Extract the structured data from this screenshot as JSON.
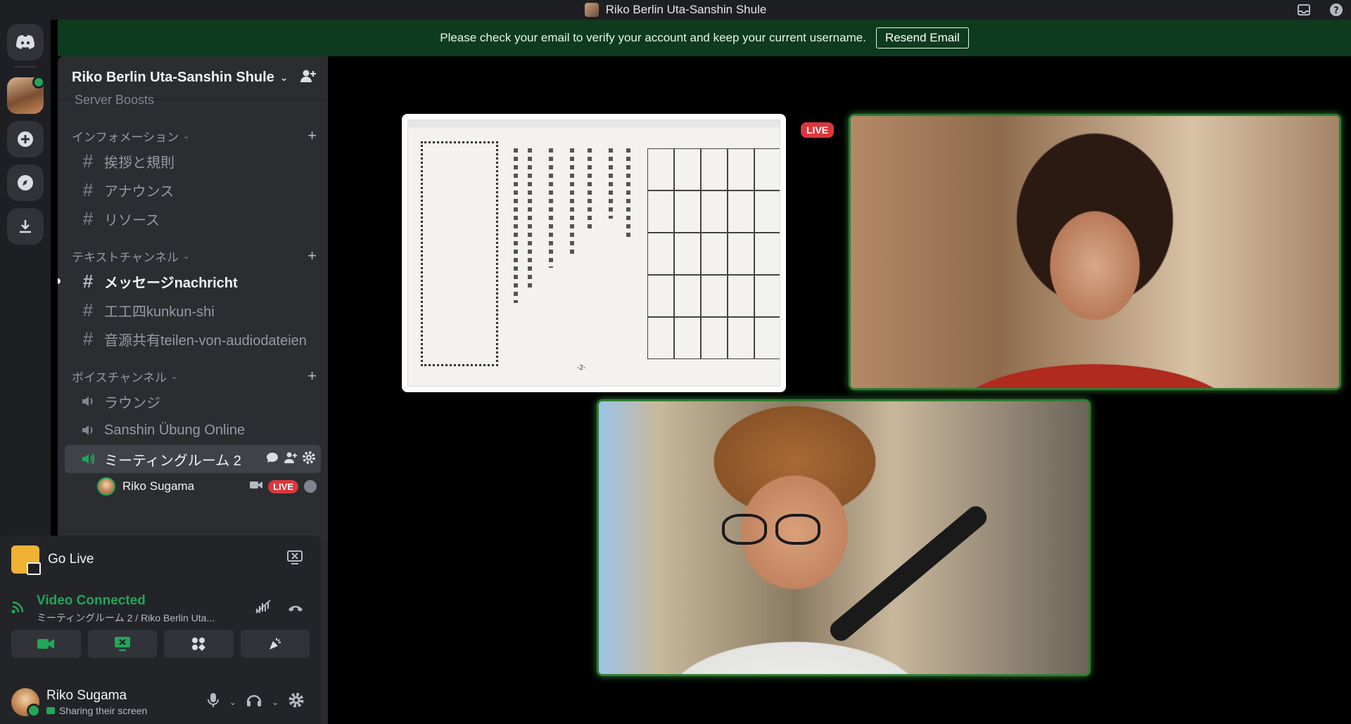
{
  "window": {
    "title": "Riko Berlin Uta-Sanshin Shule"
  },
  "banner": {
    "message": "Please check your email to verify your account and keep your current username.",
    "button": "Resend Email"
  },
  "server": {
    "name": "Riko Berlin Uta-Sanshin Shule",
    "boosts_label": "Server Boosts"
  },
  "categories": [
    {
      "name": "インフォメーション",
      "channels": [
        "挨拶と規則",
        "アナウンス",
        "リソース"
      ]
    },
    {
      "name": "テキストチャンネル",
      "channels": [
        "メッセージnachricht",
        "工工四kunkun-shi",
        "音源共有teilen-von-audiodateien"
      ]
    },
    {
      "name": "ボイスチャンネル",
      "channels": [
        "ラウンジ",
        "Sanshin Übung Online",
        "ミーティングルーム 2"
      ]
    }
  ],
  "voice_user": {
    "name": "Riko Sugama",
    "badge": "LIVE"
  },
  "go_live": {
    "label": "Go Live"
  },
  "voice_status": {
    "title": "Video Connected",
    "subtitle": "ミーティングルーム 2 / Riko Berlin Uta..."
  },
  "user": {
    "name": "Riko Sugama",
    "status": "Sharing their screen"
  },
  "stage": {
    "live_tag": "LIVE",
    "page_number": "-2-"
  },
  "colors": {
    "accent_green": "#23a55a",
    "live_red": "#da373c",
    "banner_bg": "#0e3a1f"
  }
}
